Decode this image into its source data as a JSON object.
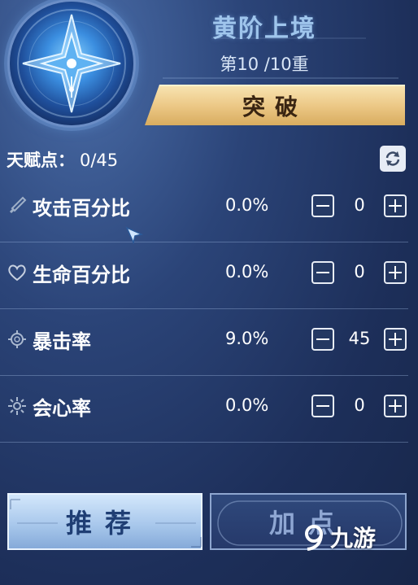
{
  "header": {
    "realm_title": "黄阶上境",
    "stage": "第10 /10重",
    "breakthrough_label": "突破"
  },
  "talent": {
    "label": "天赋点：",
    "value": "0/45"
  },
  "stats": [
    {
      "name": "攻击百分比",
      "percent": "0.0%",
      "count": "0",
      "icon": "sword-icon"
    },
    {
      "name": "生命百分比",
      "percent": "0.0%",
      "count": "0",
      "icon": "heart-icon"
    },
    {
      "name": "暴击率",
      "percent": "9.0%",
      "count": "45",
      "icon": "gear-icon"
    },
    {
      "name": "会心率",
      "percent": "0.0%",
      "count": "0",
      "icon": "star-burst-icon"
    }
  ],
  "footer": {
    "recommend_label": "推荐",
    "addpoint_label": "加点"
  },
  "watermark": {
    "text": "九游"
  },
  "colors": {
    "accent_gold": "#ecc886",
    "title_blue": "#9fc5ec",
    "background": "#1d2f5a"
  }
}
